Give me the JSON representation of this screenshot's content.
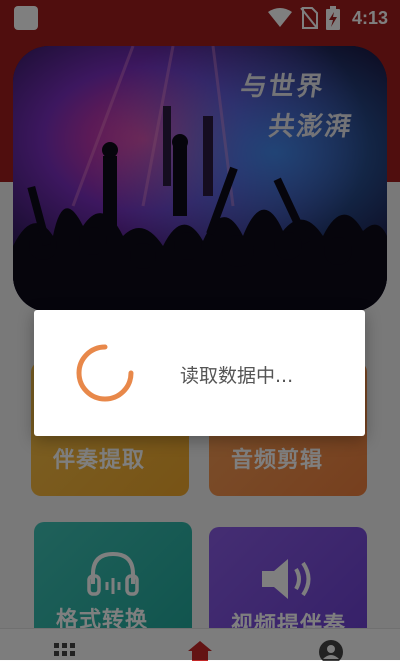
{
  "status_bar": {
    "time": "4:13",
    "icons": [
      "app-notification-icon",
      "wifi-icon",
      "no-sim-icon",
      "battery-charging-icon"
    ]
  },
  "banner": {
    "line1": "与世界",
    "line2": "共澎湃"
  },
  "tiles": [
    {
      "label": "伴奏提取",
      "icon": "none",
      "color": "#f3b43a"
    },
    {
      "label": "音频剪辑",
      "icon": "none",
      "color": "#f08e48"
    },
    {
      "label": "格式转换",
      "icon": "headphones-icon",
      "color": "#2bb3a6"
    },
    {
      "label": "视频提伴奏",
      "icon": "speaker-icon",
      "color": "#7a4edb"
    }
  ],
  "bottom_nav": {
    "items": [
      "grid-icon",
      "home-icon",
      "profile-icon"
    ],
    "active_color": "#c62828"
  },
  "dialog": {
    "message": "读取数据中...",
    "spinner_color": "#e8884a"
  }
}
